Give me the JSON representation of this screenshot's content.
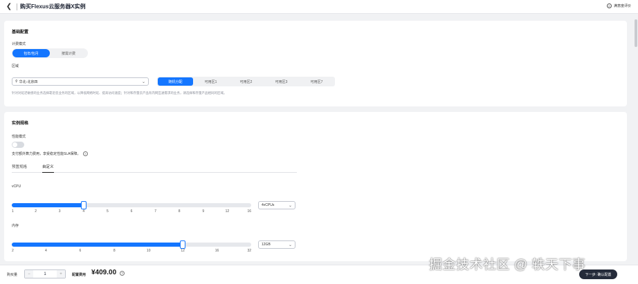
{
  "header": {
    "title": "购买Flexus云服务器X实例",
    "feedback_label": "满意度评价"
  },
  "basic": {
    "section_title": "基础配置",
    "billing_label": "计费模式",
    "billing_options": [
      "包年/包月",
      "按需计费"
    ],
    "region_label": "区域",
    "region_value": "华北-北京四",
    "az_options": [
      "随机分配",
      "可用区1",
      "可用区2",
      "可用区3",
      "可用区7"
    ],
    "region_hint": "针对对延迟敏感的业务选择靠近您业务的区域，以降低网络时延、提高访问速度；针对和存量云产品有内网互通需求的业务，请选择和存量产品相同的区域。"
  },
  "spec": {
    "section_title": "实例规格",
    "perf_mode_label": "性能模式",
    "perf_mode_on": false,
    "perf_hint": "支付额外算力费用，享受稳定性能SLA保障。",
    "tabs": [
      "预置规格",
      "自定义"
    ],
    "active_tab": 1,
    "vcpu_label": "vCPU",
    "vcpu_ticks": [
      "1",
      "2",
      "3",
      "4",
      "5",
      "6",
      "7",
      "8",
      "9",
      "12",
      "16"
    ],
    "vcpu_selected_index": 3,
    "vcpu_select_value": "4vCPUs",
    "mem_label": "内存",
    "mem_ticks": [
      "2",
      "4",
      "6",
      "8",
      "10",
      "12",
      "16",
      "32"
    ],
    "mem_selected_index": 5,
    "mem_select_value": "12GB"
  },
  "footer": {
    "quantity_label": "购买量",
    "quantity_minus": "−",
    "quantity_value": "1",
    "quantity_plus": "+",
    "price_label": "配置费用",
    "price_value": "¥409.00",
    "info_icon": "?",
    "next_button": "下一步: 确认配置"
  },
  "watermark": "掘金技术社区 @ 轶天下事",
  "colors": {
    "accent": "#1476ff",
    "dark_button": "#252b3a"
  }
}
